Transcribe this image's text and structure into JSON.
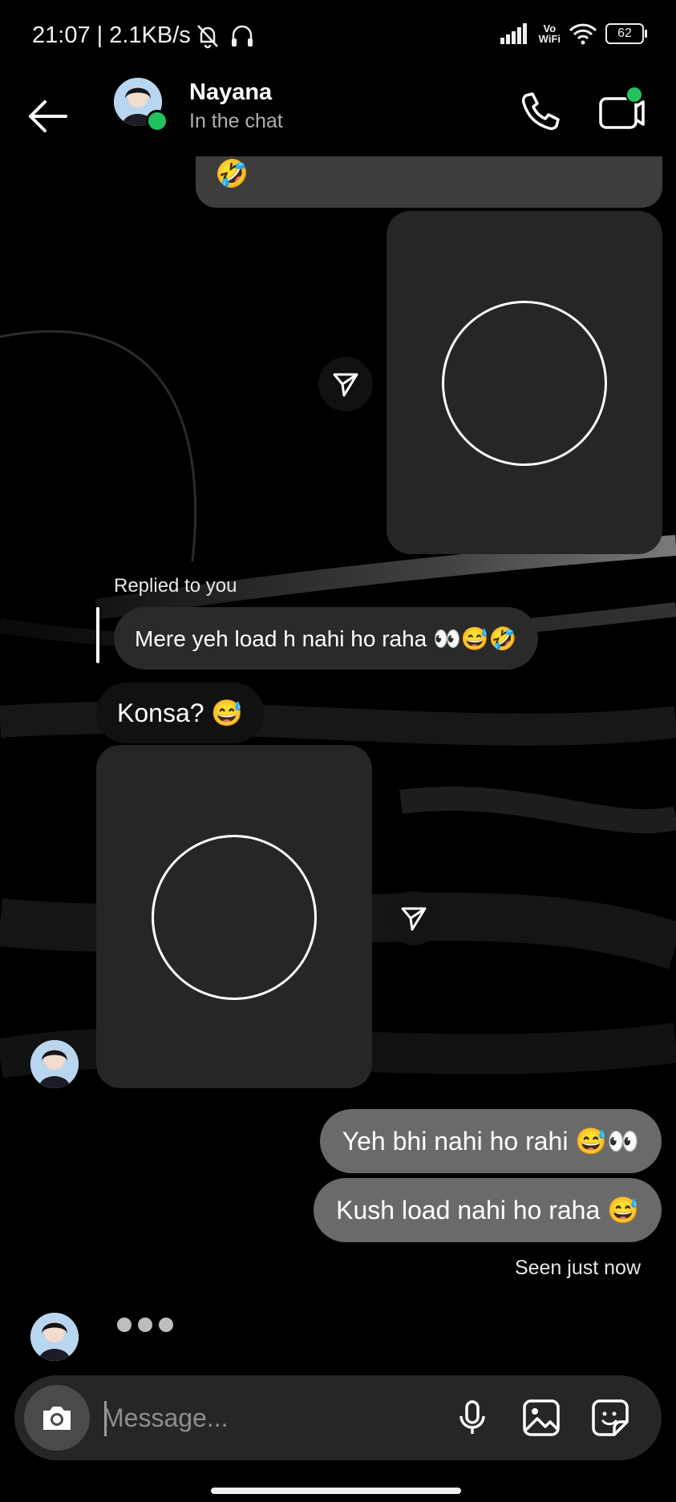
{
  "status_bar": {
    "time": "21:07 | 2.1KB/s",
    "vowifi_top": "Vo",
    "vowifi_bottom": "WiFi",
    "battery": "62"
  },
  "header": {
    "name": "Nayana",
    "status": "In the chat"
  },
  "messages": {
    "top_bubble_emoji": "🤣",
    "replied_label": "Replied to you",
    "reply_text": "Mere yeh load h nahi ho raha 👀😅🤣",
    "konsa": "Konsa? 😅",
    "out1": "Yeh bhi nahi ho rahi 😅👀",
    "out2": "Kush load nahi ho raha 😅",
    "seen": "Seen just now"
  },
  "composer": {
    "placeholder": "Message..."
  },
  "colors": {
    "background": "#000000",
    "online": "#22c35e",
    "outgoing_bubble": "#6a6a6a",
    "incoming_bubble": "#2a2a2a",
    "media_card": "#262626"
  }
}
